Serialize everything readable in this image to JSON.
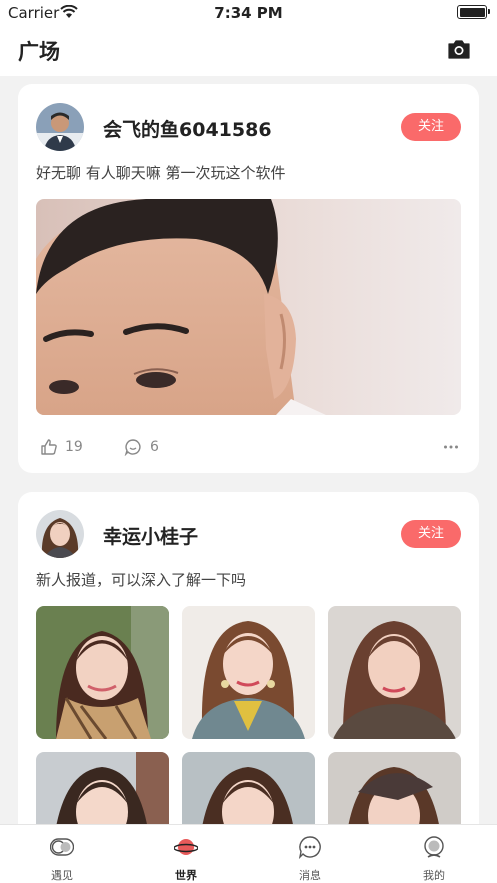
{
  "status": {
    "carrier": "Carrier",
    "time": "7:34 PM"
  },
  "nav": {
    "title": "广场",
    "camera_icon": "camera-icon"
  },
  "posts": [
    {
      "username": "会飞的鱼6041586",
      "follow_label": "关注",
      "text": "好无聊  有人聊天嘛  第一次玩这个软件",
      "likes": "19",
      "comments": "6"
    },
    {
      "username": "幸运小桂子",
      "follow_label": "关注",
      "text": "新人报道，可以深入了解一下吗"
    }
  ],
  "tabs": [
    {
      "label": "遇见",
      "icon": "toggle-icon"
    },
    {
      "label": "世界",
      "icon": "planet-icon",
      "active": true
    },
    {
      "label": "消息",
      "icon": "chat-bubble-icon"
    },
    {
      "label": "我的",
      "icon": "profile-icon"
    }
  ],
  "colors": {
    "accent": "#fa6a6a",
    "active_tab": "#e85a5a"
  }
}
